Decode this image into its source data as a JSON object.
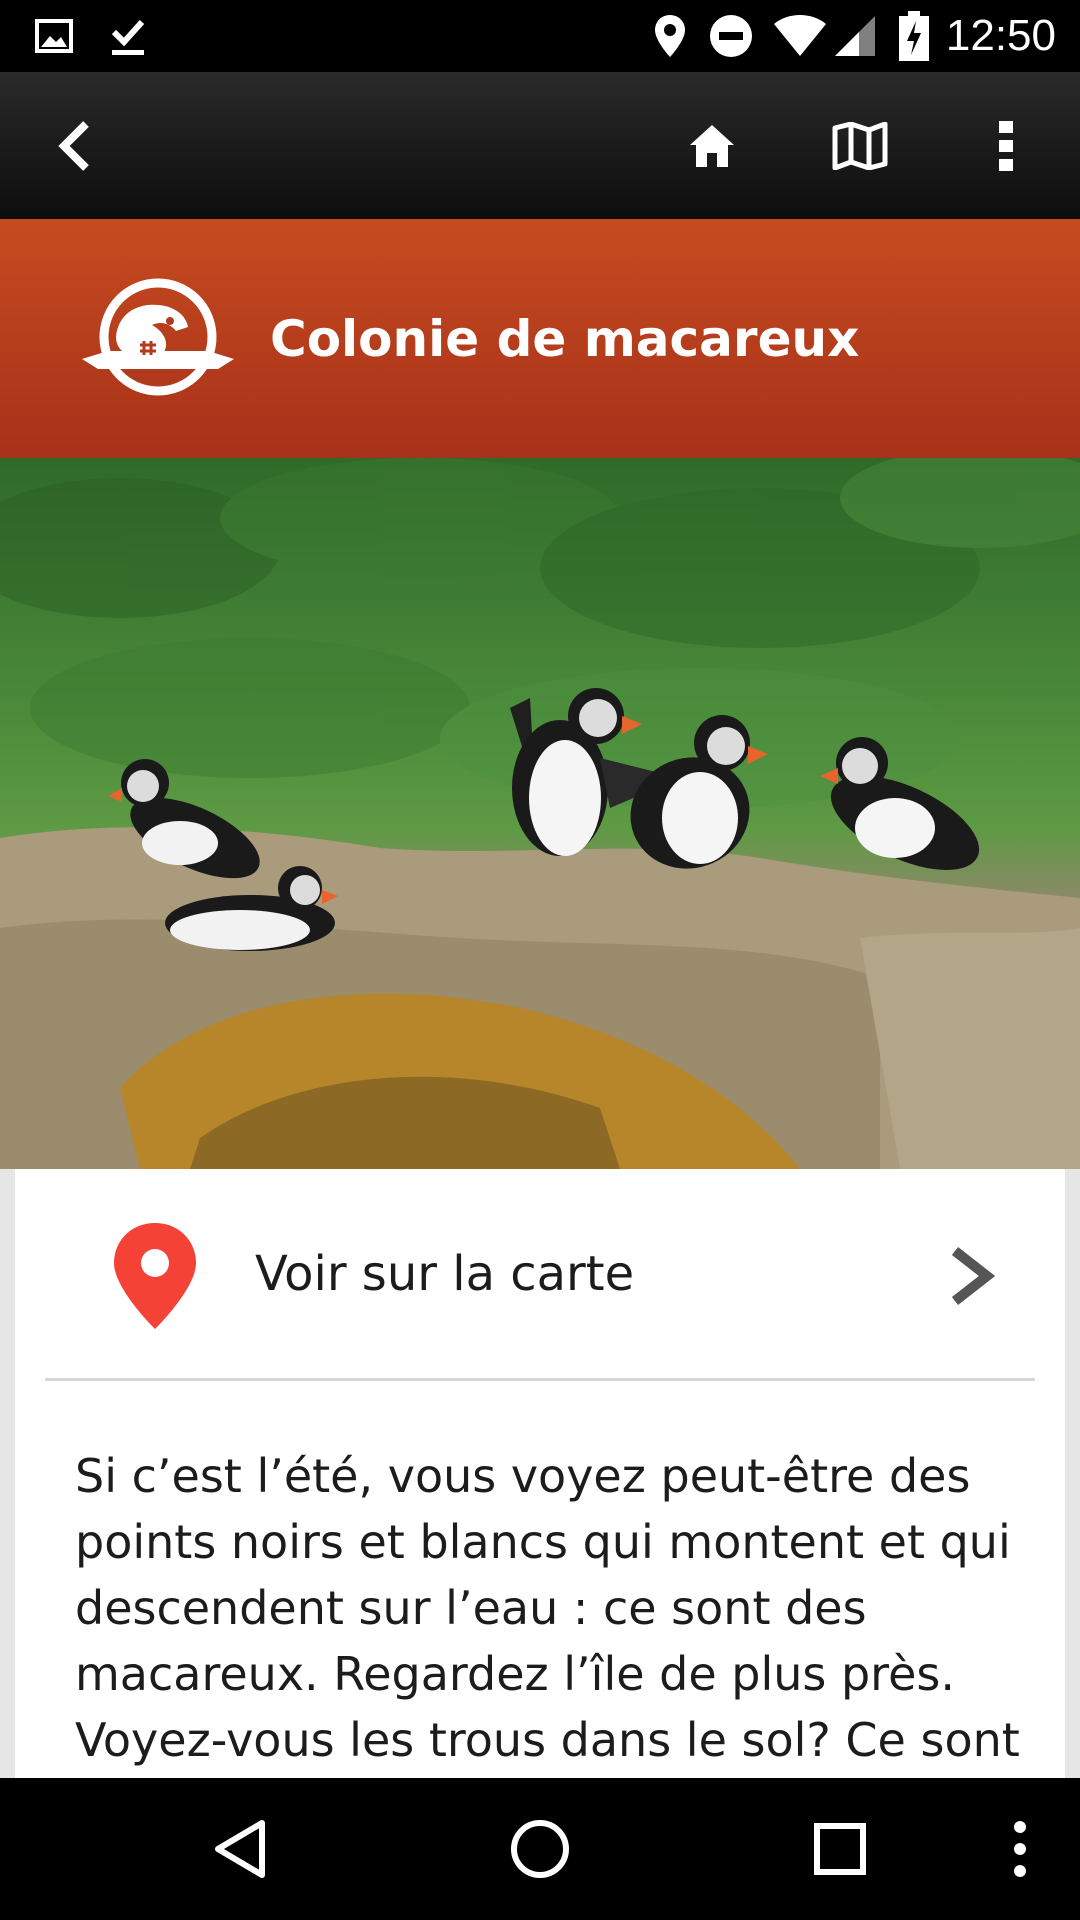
{
  "status_bar": {
    "time": "12:50",
    "icons": [
      "image-notification-icon",
      "download-done-icon",
      "location-icon",
      "do-not-disturb-icon",
      "wifi-icon",
      "cell-signal-icon",
      "battery-charging-icon"
    ]
  },
  "action_bar": {
    "icons": [
      "back-icon",
      "home-icon",
      "map-icon",
      "overflow-menu-icon"
    ]
  },
  "header": {
    "title": "Colonie de macareux",
    "logo": "parks-canada-beaver-logo"
  },
  "hero": {
    "description_icon": "puffin-photo"
  },
  "map_link": {
    "label": "Voir sur la carte",
    "icon": "map-pin-icon",
    "pin_color": "#f44336"
  },
  "description": {
    "text": "Si c’est l’été, vous voyez peut-être des points noirs et blancs qui montent et qui descendent sur l’eau : ce sont des macareux. Regardez l’île de plus près. Voyez-vous les trous dans le sol? Ce sont"
  },
  "nav_bar": {
    "icons": [
      "nav-back-icon",
      "nav-home-icon",
      "nav-recents-icon",
      "nav-menu-icon"
    ]
  },
  "colors": {
    "banner_top": "#c54b1f",
    "banner_bottom": "#a8311a",
    "action_bar": "#1a1a1a"
  }
}
